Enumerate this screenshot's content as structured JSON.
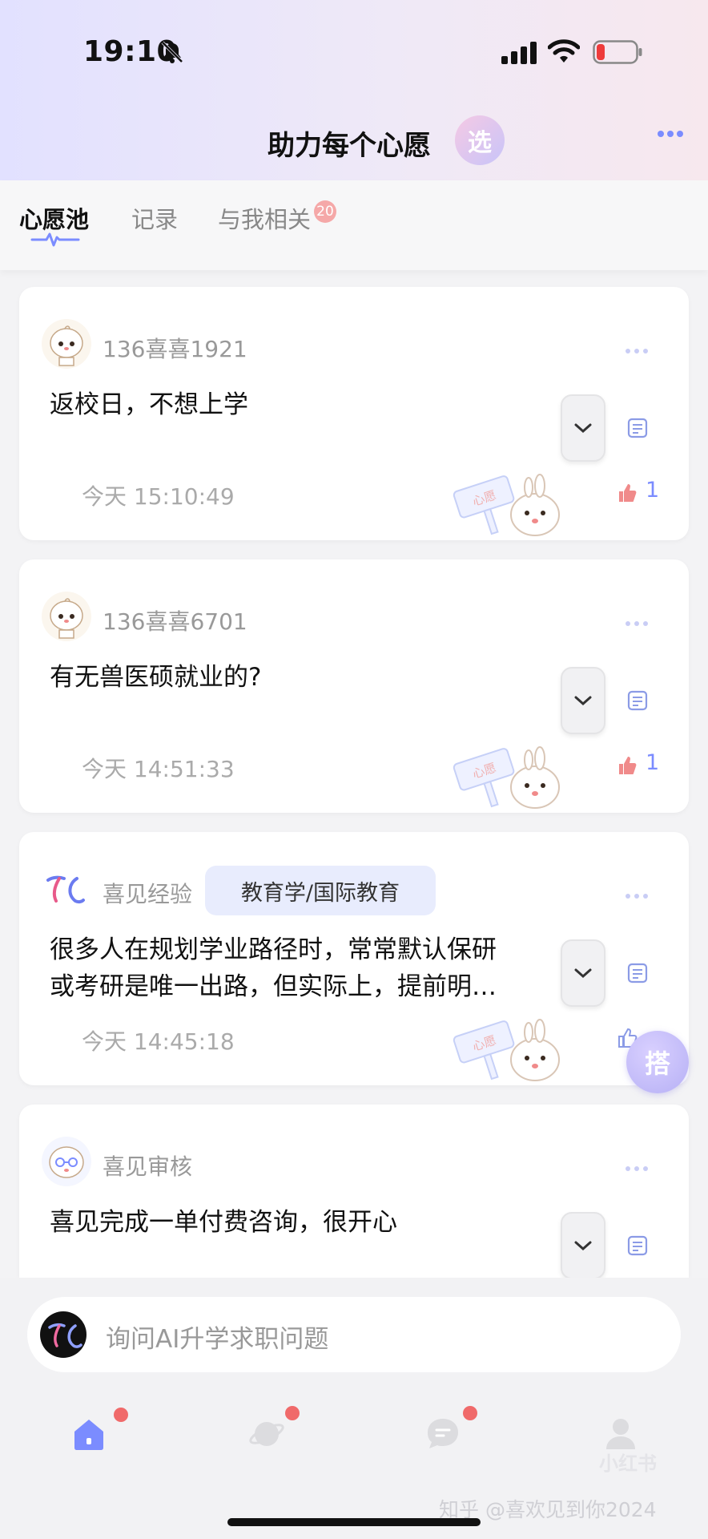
{
  "status_bar": {
    "time": "19:10"
  },
  "header": {
    "title": "助力每个心愿",
    "select_label": "选"
  },
  "tabs": [
    {
      "label": "心愿池"
    },
    {
      "label": "记录"
    },
    {
      "label": "与我相关"
    }
  ],
  "tabs_badge": "20",
  "posts": [
    {
      "username": "136喜喜1921",
      "content": "返校日，不想上学",
      "time": "今天 15:10:49",
      "likes": "1"
    },
    {
      "username": "136喜喜6701",
      "content": "有无兽医硕就业的?",
      "time": "今天 14:51:33",
      "likes": "1"
    },
    {
      "username": "喜见经验",
      "tag": "教育学/国际教育",
      "content_line1": "很多人在规划学业路径时，常常默认保研",
      "content_line2": "或考研是唯一出路，但实际上，提前明…",
      "time": "今天 14:45:18"
    },
    {
      "username": "喜见审核",
      "content": "喜见完成一单付费咨询，很开心"
    }
  ],
  "mascot_sign": "心愿",
  "float_button": "搭",
  "ask_bar": {
    "placeholder": "询问AI升学求职问题"
  },
  "bottom_nav": [
    {
      "name": "home",
      "icon": "home-icon",
      "active": true
    },
    {
      "name": "explore",
      "icon": "planet-icon"
    },
    {
      "name": "messages",
      "icon": "chat-icon"
    },
    {
      "name": "profile",
      "icon": "user-icon"
    }
  ],
  "watermark_small": "小红书",
  "watermark": "知乎 @喜欢见到你2024",
  "colors": {
    "accent": "#7b8cff",
    "badge": "#f06a6a",
    "like": "#f08a8a"
  }
}
